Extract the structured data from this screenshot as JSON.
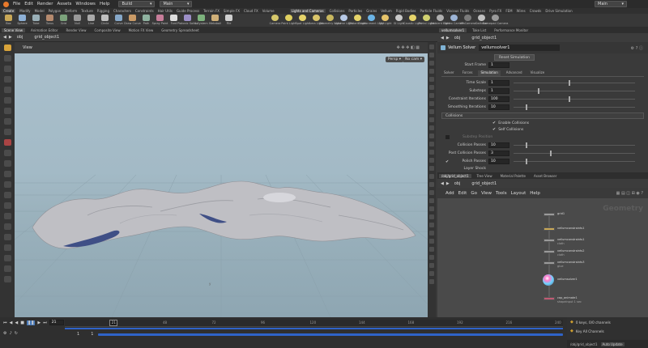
{
  "menubar": {
    "items": [
      "File",
      "Edit",
      "Render",
      "Assets",
      "Windows",
      "Help"
    ],
    "desktop": "Build",
    "context": "Main",
    "right_context": "Main"
  },
  "shelf_tabs_left": [
    "Create",
    "Modify",
    "Model",
    "Polygon",
    "Deform",
    "Texture",
    "Rigging",
    "Characters",
    "Constraints",
    "Hair Utils",
    "Guide Process",
    "Terrain FX",
    "Simple FX",
    "Cloud FX",
    "Volume"
  ],
  "shelf_tabs_right": [
    "Lights and Cameras",
    "Collisions",
    "Particles",
    "Grains",
    "Vellum",
    "Rigid Bodies",
    "Particle Fluids",
    "Viscous Fluids",
    "Oceans",
    "Pyro FX",
    "FEM",
    "Wires",
    "Crowds",
    "Drive Simulation"
  ],
  "shelf_tools_left": [
    {
      "label": "Box",
      "icon": "box-icon"
    },
    {
      "label": "Sphere",
      "icon": "sphere-icon"
    },
    {
      "label": "Tube",
      "icon": "tube-icon"
    },
    {
      "label": "Torus",
      "icon": "torus-icon"
    },
    {
      "label": "Grid",
      "icon": "grid-icon"
    },
    {
      "label": "Null",
      "icon": "null-icon"
    },
    {
      "label": "Line",
      "icon": "line-icon"
    },
    {
      "label": "Circle",
      "icon": "circle-icon"
    },
    {
      "label": "Curve",
      "icon": "curve-icon"
    },
    {
      "label": "Draw Curve",
      "icon": "draw-curve-icon"
    },
    {
      "label": "Path",
      "icon": "path-icon"
    },
    {
      "label": "Spray Paint",
      "icon": "spray-paint-icon"
    },
    {
      "label": "Font",
      "icon": "font-icon"
    },
    {
      "label": "Platonic Solids",
      "icon": "platonic-icon"
    },
    {
      "label": "L-System",
      "icon": "lsystem-icon"
    },
    {
      "label": "Metaball",
      "icon": "metaball-icon"
    },
    {
      "label": "File",
      "icon": "file-icon"
    }
  ],
  "shelf_tools_right": [
    {
      "label": "Camera",
      "icon": "camera-icon"
    },
    {
      "label": "Point Light",
      "icon": "point-light-icon"
    },
    {
      "label": "Spot Light",
      "icon": "spot-light-icon"
    },
    {
      "label": "Area Light",
      "icon": "area-light-icon"
    },
    {
      "label": "Geometry Light",
      "icon": "geo-light-icon"
    },
    {
      "label": "Volume Light",
      "icon": "volume-light-icon"
    },
    {
      "label": "Distant Light",
      "icon": "distant-light-icon"
    },
    {
      "label": "Environment Light",
      "icon": "env-light-icon"
    },
    {
      "label": "Sky Light",
      "icon": "sky-light-icon"
    },
    {
      "label": "GI Light",
      "icon": "gi-light-icon"
    },
    {
      "label": "Caustic Light",
      "icon": "caustic-light-icon"
    },
    {
      "label": "Portal Light",
      "icon": "portal-light-icon"
    },
    {
      "label": "Ambient Light",
      "icon": "ambient-light-icon"
    },
    {
      "label": "Stereo Camera",
      "icon": "stereo-camera-icon"
    },
    {
      "label": "VR Camera",
      "icon": "vr-camera-icon"
    },
    {
      "label": "Switcher",
      "icon": "switcher-icon"
    },
    {
      "label": "Gamepad Camera",
      "icon": "gamepad-icon"
    }
  ],
  "pane_tabs_left": [
    "Scene View",
    "Animation Editor",
    "Render View",
    "Composite View",
    "Motion FX View",
    "Geometry Spreadsheet"
  ],
  "pane_tabs_right": [
    "vellumsolver1",
    "Take List",
    "Performance Monitor"
  ],
  "path_left": {
    "context": "obj",
    "node": "grid_object1"
  },
  "viewport": {
    "label": "View",
    "persp": "Persp",
    "cam": "No cam",
    "axis_label": "y"
  },
  "params": {
    "path_context": "obj",
    "path_node": "grid_object1",
    "node_type": "Vellum Solver",
    "node_name": "vellumsolver1",
    "reset_button": "Reset Simulation",
    "start_frame_label": "Start Frame",
    "start_frame": "1",
    "tabs": [
      "Solver",
      "Forces",
      "Simulation",
      "Advanced",
      "Visualize"
    ],
    "active_tab": "Simulation",
    "time_scale_label": "Time Scale",
    "time_scale": "1",
    "substeps_label": "Substeps",
    "substeps": "1",
    "constraint_label": "Constraint Iterations",
    "constraint": "100",
    "smoothing_label": "Smoothing Iterations",
    "smoothing": "10",
    "collisions_header": "Collisions",
    "enable_collisions": "Enable Collisions",
    "self_collisions": "Self Collisions",
    "substep_position": "Substep Position",
    "collision_passes_label": "Collision Passes",
    "collision_passes": "10",
    "post_collision_label": "Post Collision Passes",
    "post_collision": "3",
    "polish_label": "Polish Passes",
    "polish": "10",
    "layer_shock_label": "Layer Shock",
    "slider_levels": {
      "time_scale": 0.45,
      "substeps": 0.2,
      "constraint": 0.45,
      "smoothing": 0.1,
      "collision_passes": 0.1,
      "post_collision": 0.3,
      "polish": 0.1
    }
  },
  "net_tabs": [
    "/obj/grid_object1",
    "Tree View",
    "Material Palette",
    "Asset Browser"
  ],
  "net_path": {
    "context": "obj",
    "node": "grid_object1"
  },
  "net_menu": [
    "Add",
    "Edit",
    "Go",
    "View",
    "Tools",
    "Layout",
    "Help"
  ],
  "net_watermark": "Geometry",
  "net_nodes": [
    {
      "name": "grid1",
      "sub": "",
      "color": "#9a9a9a"
    },
    {
      "name": "vellumconstraints1",
      "sub": "",
      "color": "#c9a857"
    },
    {
      "name": "vellumconstraints1",
      "sub": "cloth",
      "color": "#9a9a9a"
    },
    {
      "name": "vellumconstraints2",
      "sub": "cloth",
      "color": "#9a9a9a"
    },
    {
      "name": "vellumconstraints3",
      "sub": "glue",
      "color": "#9a9a9a"
    },
    {
      "name": "vellumsolver1",
      "sub": "",
      "color": "#9a9a9a"
    },
    {
      "name": "cap_animate1",
      "sub": "shapeinput 1 sec",
      "color": "#c05a73"
    }
  ],
  "timeline": {
    "current_frame": "21",
    "start": "1",
    "start2": "1",
    "ticks": [
      "24",
      "48",
      "72",
      "96",
      "120",
      "144",
      "168",
      "192",
      "216",
      "240"
    ],
    "progress": 0.09
  },
  "bottom_right": {
    "keys": "0 keys, 0/0 channels",
    "key_all": "Key All Channels",
    "path": "/obj/grid_object1",
    "update": "Auto Update"
  }
}
